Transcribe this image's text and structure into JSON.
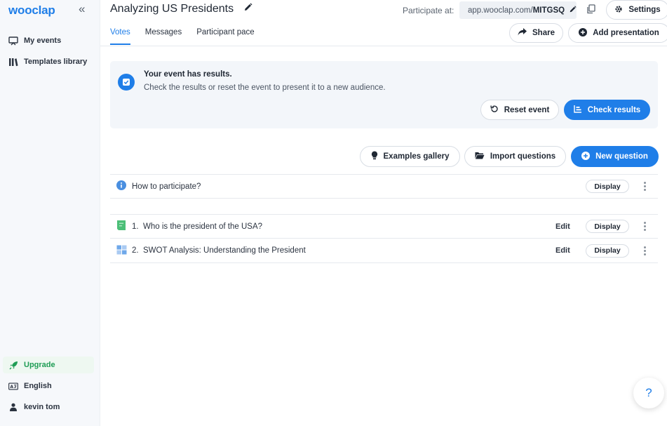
{
  "sidebar": {
    "logo": "wooclap",
    "collapse": "«",
    "items": [
      {
        "label": "My events",
        "icon": "presentation-icon"
      },
      {
        "label": "Templates library",
        "icon": "library-icon"
      }
    ],
    "bottom": [
      {
        "label": "Upgrade",
        "icon": "rocket-icon"
      },
      {
        "label": "English",
        "icon": "language-icon"
      },
      {
        "label": "kevin tom",
        "icon": "user-icon"
      }
    ]
  },
  "header": {
    "title": "Analyzing US Presidents",
    "participate_label": "Participate at:",
    "url_prefix": "app.wooclap.com/",
    "url_code": "MITGSQ",
    "settings_label": "Settings",
    "share_label": "Share",
    "add_presentation_label": "Add presentation"
  },
  "tabs": [
    {
      "label": "Votes",
      "active": true
    },
    {
      "label": "Messages",
      "active": false
    },
    {
      "label": "Participant pace",
      "active": false
    }
  ],
  "banner": {
    "title": "Your event has results.",
    "text": "Check the results or reset the event to present it to a new audience.",
    "reset_label": "Reset event",
    "check_label": "Check results"
  },
  "toolbar": {
    "examples_label": "Examples gallery",
    "import_label": "Import questions",
    "new_question_label": "New question"
  },
  "intro_row": {
    "label": "How to participate?",
    "display_label": "Display"
  },
  "questions": [
    {
      "number": "1.",
      "label": "Who is the president of the USA?",
      "edit_label": "Edit",
      "display_label": "Display"
    },
    {
      "number": "2.",
      "label": "SWOT Analysis: Understanding the President",
      "edit_label": "Edit",
      "display_label": "Display"
    }
  ],
  "help_label": "?",
  "colors": {
    "accent": "#1f7ee8",
    "upgrade": "#1f9d55"
  }
}
